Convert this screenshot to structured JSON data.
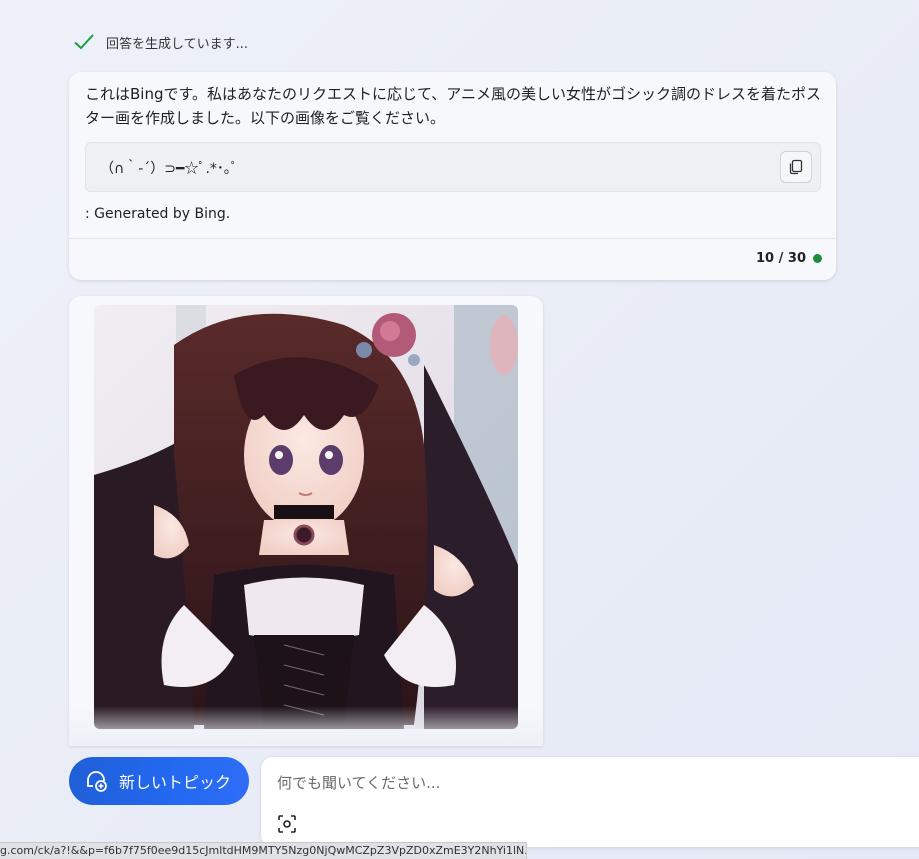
{
  "status": {
    "text": "回答を生成しています...",
    "icon": "check-icon",
    "color": "#1a9c3e"
  },
  "message": {
    "text": "これはBingです。私はあなたのリクエストに応じて、アニメ風の美しい女性がゴシック調のドレスを着たポスター画を作成しました。以下の画像をご覧ください。",
    "code": "（∩｀-´）⊃━☆ﾟ.*･｡ﾟ",
    "copy_icon": "copy-icon",
    "generated": ": Generated by Bing.",
    "counter": "10 / 30",
    "counter_dot_color": "#1e8e3e"
  },
  "image": {
    "icon": "generated-image"
  },
  "composer": {
    "new_topic_label": "新しいトピック",
    "new_topic_icon": "new-chat-icon",
    "placeholder": "何でも聞いてください...",
    "scan_icon": "visual-search-icon",
    "accent": "#2369f2"
  },
  "statusbar": {
    "url": "g.com/ck/a?!&&p=f6b7f75f0ee9d15cJmltdHM9MTY5Nzg0NjQwMCZpZ3VpZD0xZmE3Y2NhYi1lN..."
  }
}
